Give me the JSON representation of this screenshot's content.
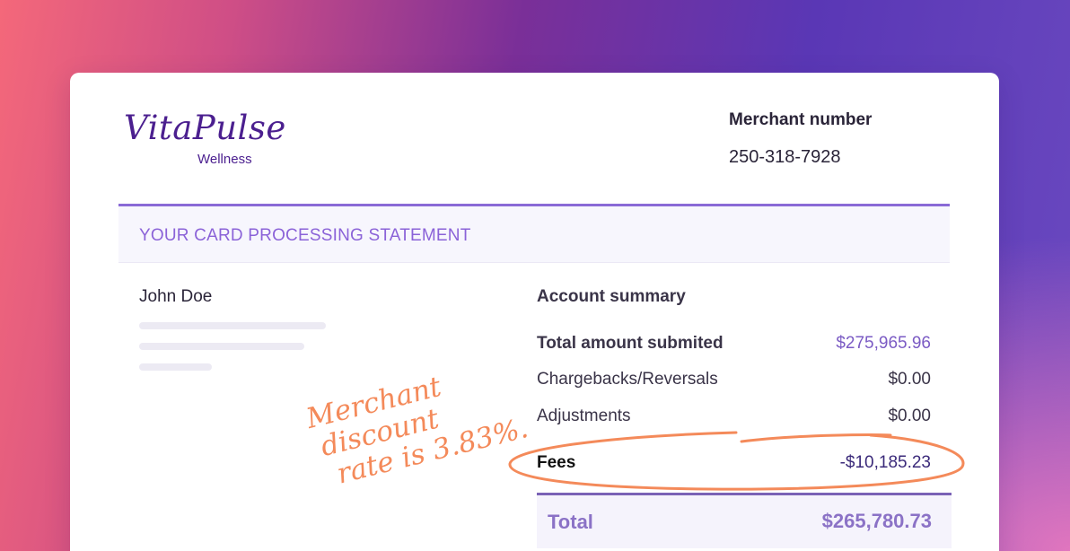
{
  "brand": {
    "name": "VitaPulse",
    "tagline": "Wellness"
  },
  "merchant": {
    "label": "Merchant number",
    "number": "250-318-7928"
  },
  "statement": {
    "title": "YOUR CARD PROCESSING STATEMENT"
  },
  "customer": {
    "name": "John Doe"
  },
  "summary": {
    "title": "Account summary",
    "rows": [
      {
        "label": "Total amount submited",
        "value": "$275,965.96"
      },
      {
        "label": "Chargebacks/Reversals",
        "value": "$0.00"
      },
      {
        "label": "Adjustments",
        "value": "$0.00"
      },
      {
        "label": "Fees",
        "value": "-$10,185.23"
      }
    ],
    "total_label": "Total",
    "total_value": "$265,780.73"
  },
  "annotation": {
    "line1": "Merchant",
    "line2": "discount",
    "line3": "rate is 3.83%."
  },
  "colors": {
    "accent": "#8a6ad6",
    "brand": "#4b1f8f",
    "annotation": "#f48a5a"
  }
}
